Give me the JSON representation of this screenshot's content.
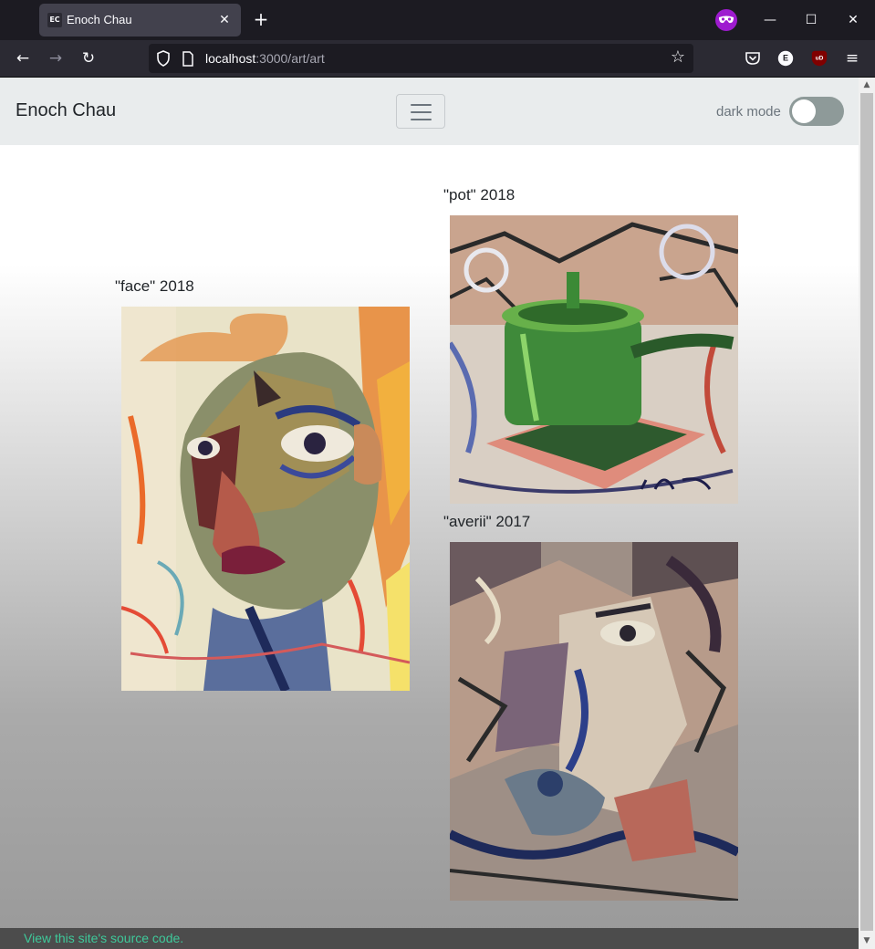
{
  "browser": {
    "tab_title": "Enoch Chau",
    "tab_favicon_text": "EC",
    "url_host": "localhost",
    "url_rest": ":3000/art/art",
    "icons": {
      "back": "back-arrow-icon",
      "forward": "forward-arrow-icon",
      "reload": "reload-icon",
      "bookmark": "star-icon",
      "pocket": "pocket-icon",
      "menu": "hamburger-menu-icon"
    },
    "profile_color": "#9e1bcf",
    "extension_e_label": "E",
    "extension_ub_label": "uD"
  },
  "header": {
    "brand": "Enoch Chau",
    "dark_mode_label": "dark mode",
    "dark_mode_on": false
  },
  "artworks": [
    {
      "caption": "\"face\" 2018",
      "alt": "face painting"
    },
    {
      "caption": "\"pot\" 2018",
      "alt": "pot painting"
    },
    {
      "caption": "\"averii\" 2017",
      "alt": "averii painting"
    }
  ],
  "footer": {
    "source_link": "View this site's source code.",
    "link_color": "#3ec99a"
  }
}
